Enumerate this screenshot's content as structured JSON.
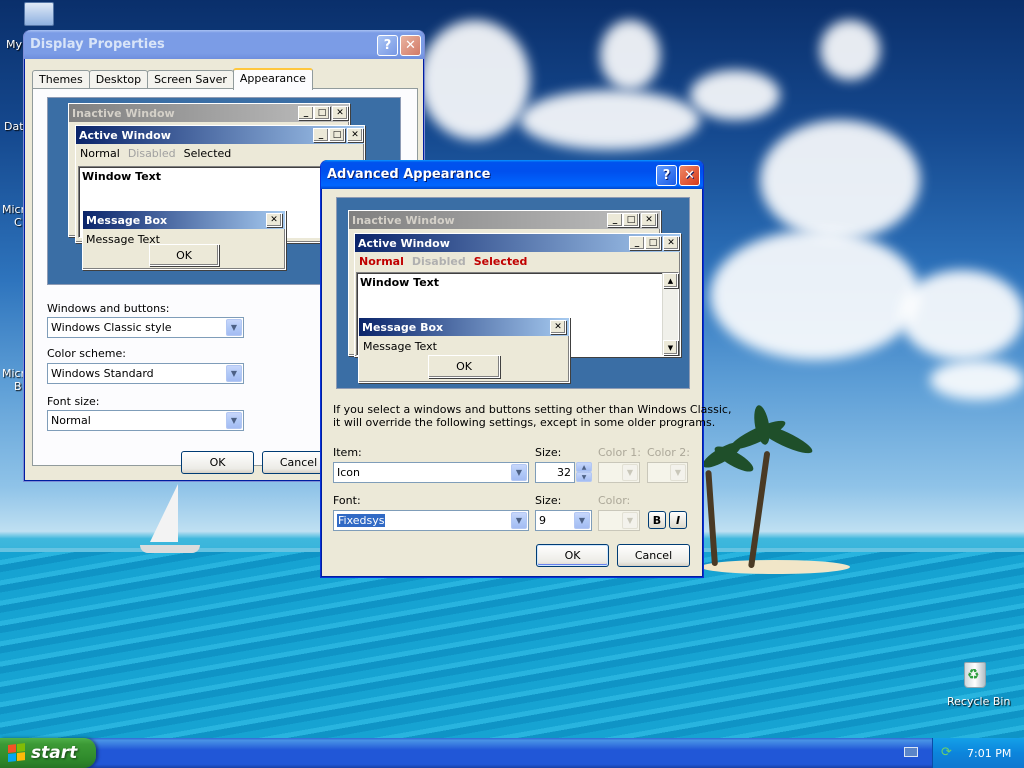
{
  "desktop": {
    "icons": [
      {
        "label": "My",
        "name": "my-computer"
      },
      {
        "label": "Dat",
        "name": "data"
      },
      {
        "label": "Micro",
        "name": "micro-1"
      },
      {
        "label": "C",
        "name": "micro-1b"
      },
      {
        "label": "Micro",
        "name": "micro-2"
      },
      {
        "label": "B",
        "name": "micro-2b"
      },
      {
        "label": "Recycle Bin",
        "name": "recycle-bin"
      }
    ]
  },
  "display_properties": {
    "title": "Display Properties",
    "tabs": [
      "Themes",
      "Desktop",
      "Screen Saver",
      "Appearance"
    ],
    "active_tab": "Appearance",
    "preview": {
      "inactive_title": "Inactive Window",
      "active_title": "Active Window",
      "menu": [
        "Normal",
        "Disabled",
        "Selected"
      ],
      "window_text": "Window Text",
      "msgbox_title": "Message Box",
      "msgbox_text": "Message Text",
      "ok": "OK"
    },
    "windows_buttons_label": "Windows and buttons:",
    "windows_buttons_value": "Windows Classic style",
    "color_scheme_label": "Color scheme:",
    "color_scheme_value": "Windows Standard",
    "font_size_label": "Font size:",
    "font_size_value": "Normal",
    "ok": "OK",
    "cancel": "Cancel"
  },
  "advanced": {
    "title": "Advanced Appearance",
    "preview": {
      "inactive_title": "Inactive Window",
      "active_title": "Active Window",
      "menu": [
        "Normal",
        "Disabled",
        "Selected"
      ],
      "window_text": "Window Text",
      "msgbox_title": "Message Box",
      "msgbox_text": "Message Text",
      "ok": "OK"
    },
    "info_line1": "If you select a windows and buttons setting other than Windows Classic,",
    "info_line2": "it will override the following settings, except in some older programs.",
    "item_label": "Item:",
    "item_value": "Icon",
    "size1_label": "Size:",
    "size1_value": "32",
    "color1_label": "Color 1:",
    "color2_label": "Color 2:",
    "font_label": "Font:",
    "font_value": "Fixedsys",
    "size2_label": "Size:",
    "size2_value": "9",
    "color_label": "Color:",
    "bold_label": "B",
    "italic_label": "I",
    "ok": "OK",
    "cancel": "Cancel"
  },
  "taskbar": {
    "start": "start",
    "clock": "7:01 PM"
  },
  "icons": {
    "help": "?",
    "close": "✕",
    "minimize": "_",
    "maximize": "□",
    "dropdown": "▼",
    "up": "▲",
    "down": "▼"
  }
}
